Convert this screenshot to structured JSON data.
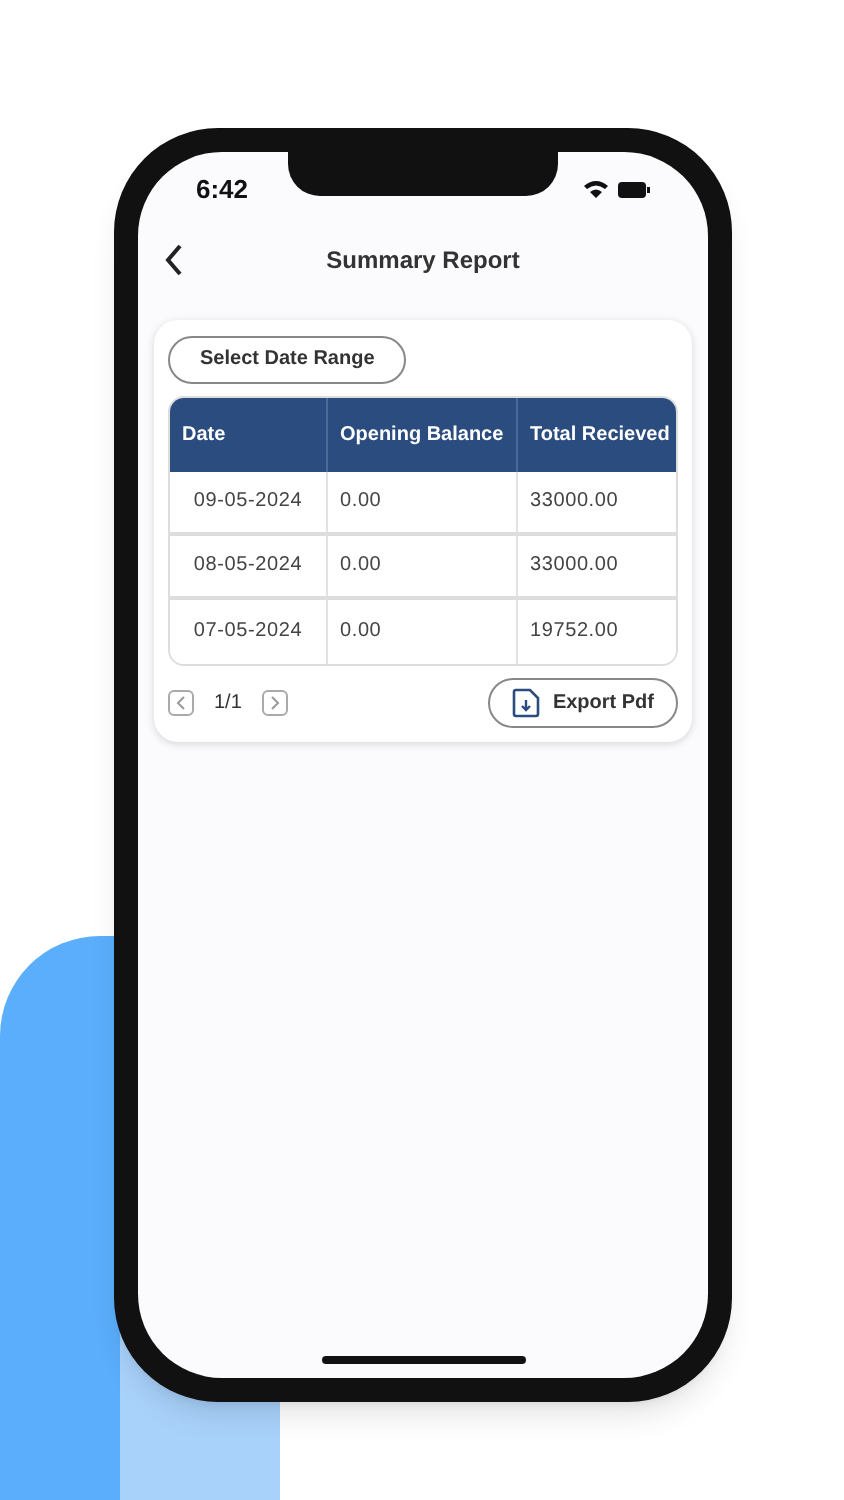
{
  "status_bar": {
    "time": "6:42"
  },
  "header": {
    "title": "Summary Report"
  },
  "date_range_button": "Select Date Range",
  "table": {
    "columns": [
      "Date",
      "Opening Balance",
      "Total Recieved"
    ],
    "rows": [
      [
        "09-05-2024",
        "0.00",
        "33000.00"
      ],
      [
        "08-05-2024",
        "0.00",
        "33000.00"
      ],
      [
        "07-05-2024",
        "0.00",
        "19752.00"
      ]
    ]
  },
  "pagination": {
    "page": "1/1"
  },
  "export_button": "Export Pdf"
}
